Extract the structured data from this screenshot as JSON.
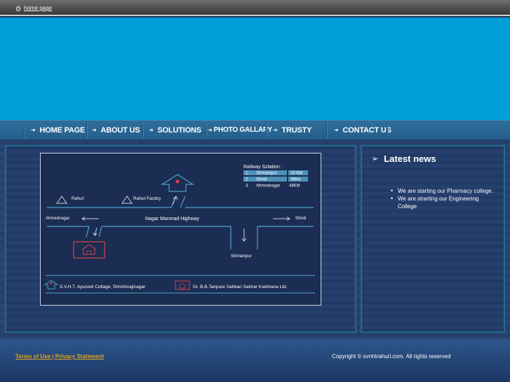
{
  "topbar": {
    "home_label": "home page"
  },
  "nav": {
    "items": [
      {
        "label": "HOME PAGE"
      },
      {
        "label": "ABOUT US"
      },
      {
        "label": "SOLUTIONS"
      },
      {
        "label": "PHOTO GALLARY"
      },
      {
        "label": "TRUSTY"
      },
      {
        "label": "CONTACT US"
      }
    ]
  },
  "map": {
    "railway_title": "Railway Sztation :",
    "stations": [
      {
        "num": "1.",
        "name": "Shrirampur",
        "dist": "19 KM"
      },
      {
        "num": "2.",
        "name": "Shirdi",
        "dist": "38km"
      },
      {
        "num": "3.",
        "name": "Ahmednagar",
        "dist": "48KM"
      }
    ],
    "places": {
      "rahuri": "Rahuri",
      "rahuri_factory": "Rahuri Factdry",
      "ahmednagar": "Ahmednagar",
      "highway": "Nagar Manmad Highway",
      "shirdi": "Shirdi",
      "shrirampur": "Shrirampur"
    },
    "legend_college": "S.V.H.T. Ayurved Collage, Shrishivajinagar",
    "legend_factory": "Dr. B.B.Tanpure Sahkari Sakhar Karkhana Ltd."
  },
  "news": {
    "title": "Latest news",
    "items": [
      "We are starting our Pharmacy college.",
      "We are strarting our Engineering College"
    ]
  },
  "footer": {
    "terms": "Terms of Use",
    "separator": " | ",
    "privacy": "Privacy Statement",
    "copyright": "Copyright © svnhtrahuri.com. All rights reserved"
  },
  "colors": {
    "banner": "#009ed8",
    "nav": "#2a6a96",
    "footer_link": "#e2a21c",
    "map_line": "#4ea2c9",
    "map_red": "#d9434a"
  }
}
